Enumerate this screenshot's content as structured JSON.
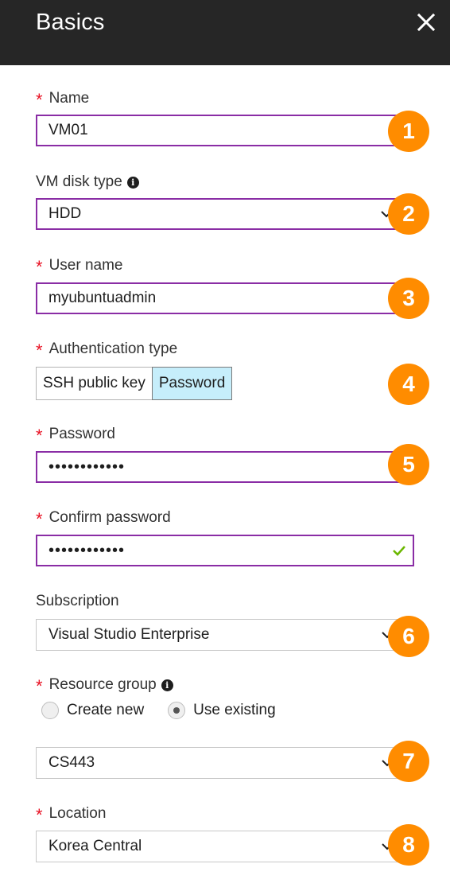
{
  "header": {
    "title": "Basics",
    "close_icon": "close-icon"
  },
  "fields": {
    "name": {
      "label": "Name",
      "required": true,
      "value": "VM01"
    },
    "disk_type": {
      "label": "VM disk type",
      "value": "HDD"
    },
    "user_name": {
      "label": "User name",
      "required": true,
      "value": "myubuntuadmin"
    },
    "auth_type": {
      "label": "Authentication type",
      "required": true,
      "options": [
        "SSH public key",
        "Password"
      ],
      "selected": "Password"
    },
    "password": {
      "label": "Password",
      "required": true,
      "value": "••••••••••••"
    },
    "confirm_password": {
      "label": "Confirm password",
      "required": true,
      "value": "••••••••••••"
    },
    "subscription": {
      "label": "Subscription",
      "value": "Visual Studio Enterprise"
    },
    "resource_group": {
      "label": "Resource group",
      "required": true,
      "radio_options": [
        "Create new",
        "Use existing"
      ],
      "radio_selected": "Use existing",
      "value": "CS443"
    },
    "location": {
      "label": "Location",
      "required": true,
      "value": "Korea Central"
    }
  },
  "badges": [
    "1",
    "2",
    "3",
    "4",
    "5",
    "6",
    "7",
    "8"
  ],
  "colors": {
    "header_bg": "#262626",
    "required_star": "#e81123",
    "focus_border": "#8a2da5",
    "badge": "#ff8c00",
    "toggle_active": "#c6eefb",
    "valid_check": "#6bb700"
  },
  "required_marker": "*"
}
